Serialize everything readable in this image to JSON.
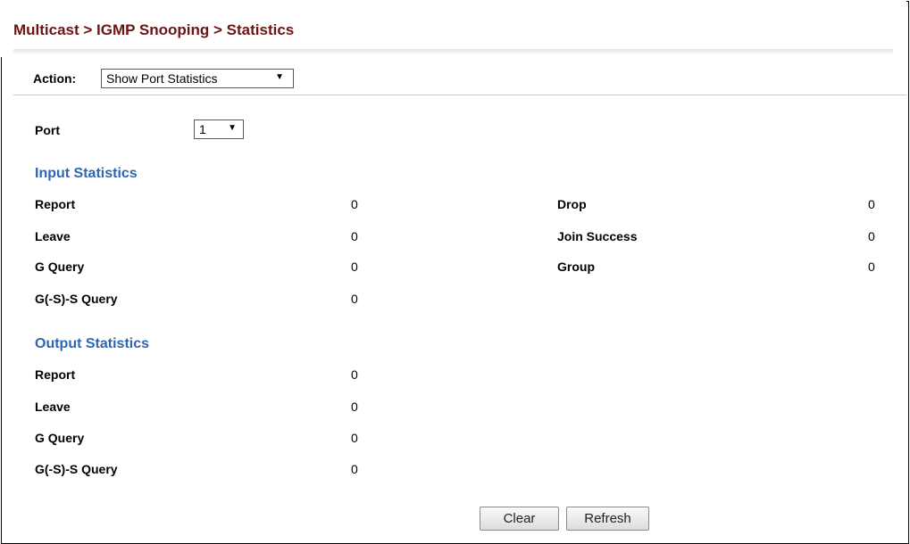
{
  "header": {
    "title": "Multicast > IGMP Snooping > Statistics"
  },
  "action": {
    "label": "Action:",
    "selected": "Show Port Statistics"
  },
  "port": {
    "label": "Port",
    "selected": "1"
  },
  "input_statistics": {
    "title": "Input Statistics",
    "left": [
      {
        "label": "Report",
        "value": "0"
      },
      {
        "label": "Leave",
        "value": "0"
      },
      {
        "label": "G Query",
        "value": "0"
      },
      {
        "label": "G(-S)-S Query",
        "value": "0"
      }
    ],
    "right": [
      {
        "label": "Drop",
        "value": "0"
      },
      {
        "label": "Join Success",
        "value": "0"
      },
      {
        "label": "Group",
        "value": "0"
      }
    ]
  },
  "output_statistics": {
    "title": "Output Statistics",
    "rows": [
      {
        "label": "Report",
        "value": "0"
      },
      {
        "label": "Leave",
        "value": "0"
      },
      {
        "label": "G Query",
        "value": "0"
      },
      {
        "label": "G(-S)-S Query",
        "value": "0"
      }
    ]
  },
  "buttons": {
    "clear": "Clear",
    "refresh": "Refresh"
  }
}
